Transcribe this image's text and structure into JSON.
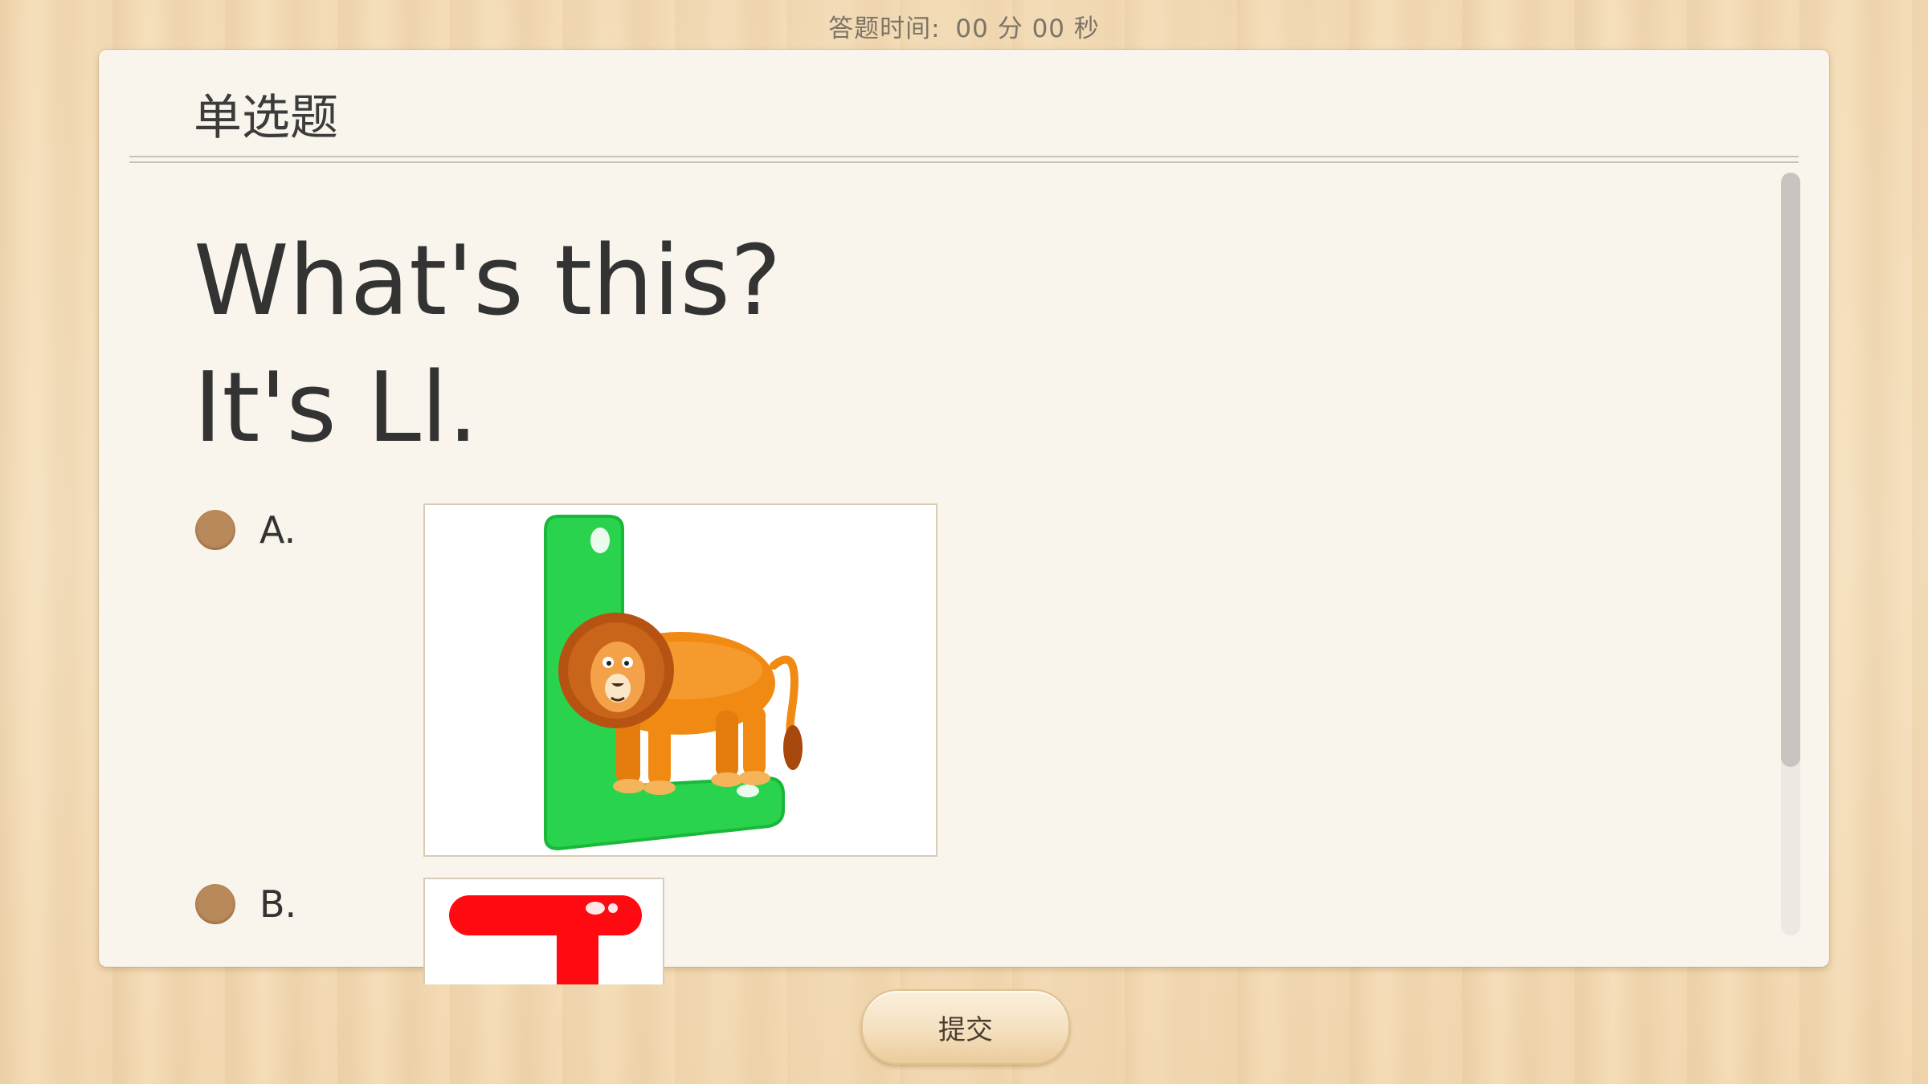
{
  "timer": {
    "label": "答题时间:",
    "minutes": "00",
    "minutes_unit": "分",
    "seconds": "00",
    "seconds_unit": "秒"
  },
  "question": {
    "type": "单选题",
    "line1": "What's this?",
    "line2": "It's Ll."
  },
  "options": [
    {
      "label": "A.",
      "image": "letter-l-lion-picture"
    },
    {
      "label": "B.",
      "image": "letter-t-picture"
    }
  ],
  "submit": {
    "label": "提交"
  },
  "colors": {
    "radio": "#b8895a",
    "card": "#f9f5ed",
    "letter_l": "#2ad34e",
    "letter_t": "#ff0a10"
  }
}
